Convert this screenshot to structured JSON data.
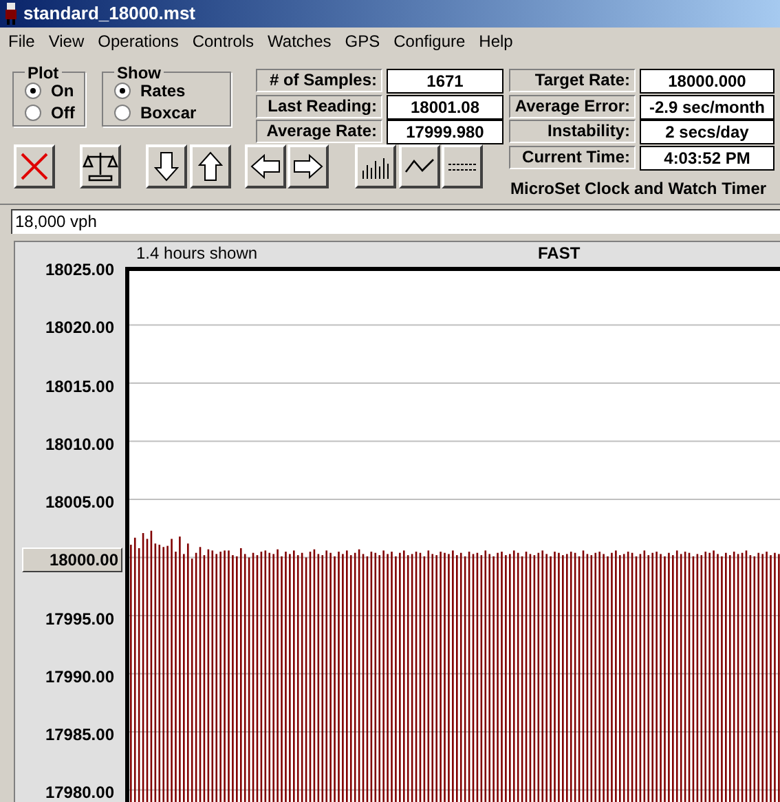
{
  "window": {
    "title": "standard_18000.mst"
  },
  "menu": [
    "File",
    "View",
    "Operations",
    "Controls",
    "Watches",
    "GPS",
    "Configure",
    "Help"
  ],
  "plot_group": {
    "title": "Plot",
    "options": [
      {
        "label": "On",
        "selected": true
      },
      {
        "label": "Off",
        "selected": false
      }
    ]
  },
  "show_group": {
    "title": "Show",
    "options": [
      {
        "label": "Rates",
        "selected": true
      },
      {
        "label": "Boxcar",
        "selected": false
      }
    ]
  },
  "stats_left": [
    {
      "label": "# of Samples:",
      "value": "1671"
    },
    {
      "label": "Last Reading:",
      "value": "18001.08"
    },
    {
      "label": "Average Rate:",
      "value": "17999.980"
    }
  ],
  "stats_right": [
    {
      "label": "Target Rate:",
      "value": "18000.000"
    },
    {
      "label": "Average Error:",
      "value": "-2.9 sec/month"
    },
    {
      "label": "Instability:",
      "value": "2 secs/day"
    },
    {
      "label": "Current Time:",
      "value": "4:03:52 PM"
    }
  ],
  "app_name": "MicroSet Clock and Watch Timer",
  "rate_field": {
    "value": "18,000 vph"
  },
  "chart": {
    "span_label": "1.4 hours shown",
    "chart_data": {
      "type": "bar",
      "title": "FAST",
      "ylim": [
        17980,
        18025
      ],
      "yticks": [
        {
          "value": 18025,
          "label": "18025.00"
        },
        {
          "value": 18020,
          "label": "18020.00"
        },
        {
          "value": 18015,
          "label": "18015.00"
        },
        {
          "value": 18010,
          "label": "18010.00"
        },
        {
          "value": 18005,
          "label": "18005.00"
        },
        {
          "value": 18000,
          "label": "18000.00"
        },
        {
          "value": 17995,
          "label": "17995.00"
        },
        {
          "value": 17990,
          "label": "17990.00"
        },
        {
          "value": 17985,
          "label": "17985.00"
        },
        {
          "value": 17980,
          "label": "17980.00"
        }
      ],
      "grid": true,
      "series": [
        {
          "color": "#800000",
          "values": [
            18001.1,
            18001.7,
            18000.8,
            18002.1,
            18001.6,
            18002.3,
            18001.2,
            18001.1,
            18000.9,
            18001.0,
            18001.6,
            18000.5,
            18001.8,
            18000.3,
            18001.2,
            17999.9,
            18000.4,
            18000.9,
            18000.2,
            18000.7,
            18000.6,
            18000.3,
            18000.5,
            18000.6,
            18000.6,
            18000.2,
            18000.1,
            18000.8,
            18000.3,
            18000.0,
            18000.4,
            18000.2,
            18000.5,
            18000.6,
            18000.4,
            18000.3,
            18000.7,
            18000.1,
            18000.5,
            18000.3,
            18000.6,
            18000.2,
            18000.4,
            18000.0,
            18000.5,
            18000.7,
            18000.3,
            18000.2,
            18000.6,
            18000.4,
            18000.1,
            18000.5,
            18000.3,
            18000.6,
            18000.2,
            18000.4,
            18000.7,
            18000.3,
            18000.1,
            18000.5,
            18000.4,
            18000.2,
            18000.6,
            18000.3,
            18000.5,
            18000.1,
            18000.4,
            18000.6,
            18000.2,
            18000.3,
            18000.5,
            18000.4,
            18000.1,
            18000.6,
            18000.3,
            18000.2,
            18000.5,
            18000.4,
            18000.3,
            18000.6,
            18000.2,
            18000.4,
            18000.1,
            18000.5,
            18000.3,
            18000.4,
            18000.2,
            18000.6,
            18000.3,
            18000.1,
            18000.4,
            18000.5,
            18000.2,
            18000.3,
            18000.6,
            18000.4,
            18000.1,
            18000.5,
            18000.3,
            18000.2,
            18000.4,
            18000.6,
            18000.3,
            18000.1,
            18000.5,
            18000.4,
            18000.2,
            18000.3,
            18000.5,
            18000.4,
            18000.1,
            18000.6,
            18000.3,
            18000.2,
            18000.4,
            18000.5,
            18000.3,
            18000.1,
            18000.4,
            18000.6,
            18000.2,
            18000.3,
            18000.5,
            18000.4,
            18000.1,
            18000.3,
            18000.6,
            18000.2,
            18000.4,
            18000.5,
            18000.3,
            18000.1,
            18000.4,
            18000.2,
            18000.6,
            18000.3,
            18000.5,
            18000.4,
            18000.1,
            18000.3,
            18000.2,
            18000.5,
            18000.4,
            18000.6,
            18000.3,
            18000.1,
            18000.4,
            18000.2,
            18000.5,
            18000.3,
            18000.4,
            18000.6,
            18000.2,
            18000.1,
            18000.4,
            18000.3,
            18000.5,
            18000.2,
            18000.4,
            18000.3
          ]
        }
      ]
    }
  }
}
